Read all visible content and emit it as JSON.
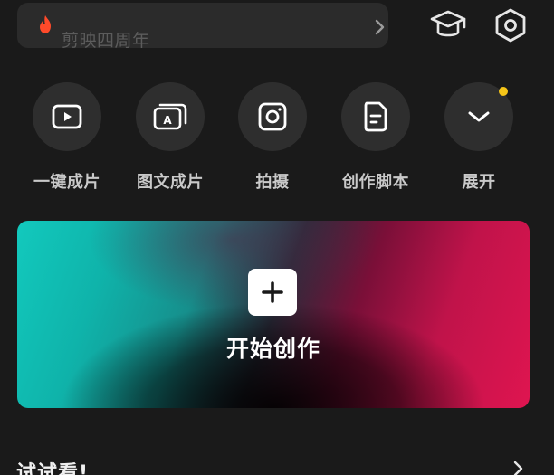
{
  "search": {
    "placeholder": "剪映四周年",
    "flame_color": "#ff4a2a"
  },
  "header_icons": [
    "graduation-cap-icon",
    "settings-hexagon-icon"
  ],
  "actions": [
    {
      "label": "一键成片",
      "icon": "play-video-icon"
    },
    {
      "label": "图文成片",
      "icon": "text-to-video-icon"
    },
    {
      "label": "拍摄",
      "icon": "camera-icon"
    },
    {
      "label": "创作脚本",
      "icon": "script-document-icon"
    },
    {
      "label": "展开",
      "icon": "chevron-down-icon",
      "has_badge": true
    }
  ],
  "banner": {
    "title": "开始创作",
    "colors": {
      "left": "#12c9bd",
      "right": "#df1550"
    }
  },
  "section": {
    "title": "试试看!"
  },
  "colors": {
    "background": "#1a1a1a",
    "badge": "#f5c518"
  }
}
